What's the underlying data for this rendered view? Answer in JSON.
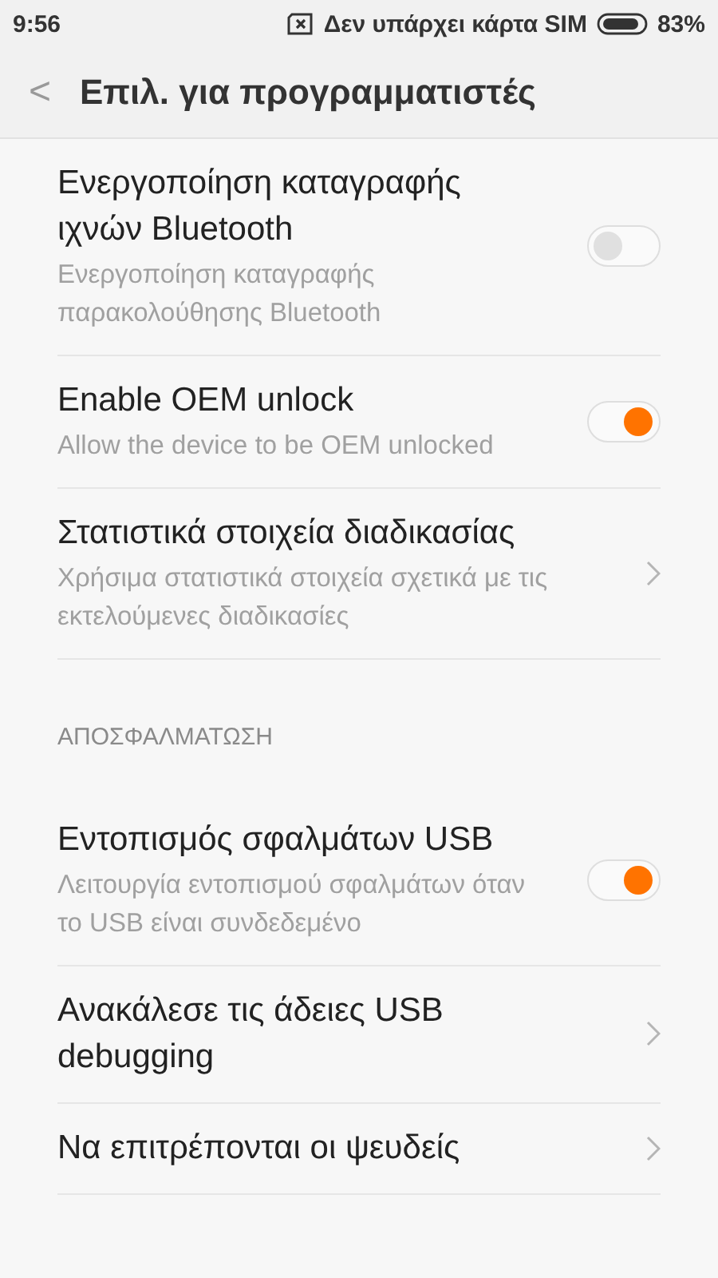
{
  "status_bar": {
    "time": "9:56",
    "carrier": "Δεν υπάρχει κάρτα SIM",
    "battery": "83%"
  },
  "header": {
    "back": "<",
    "title": "Επιλ. για προγραμματιστές"
  },
  "items": [
    {
      "kind": "toggle",
      "title": "Ενεργοποίηση καταγραφής ιχνών Bluetooth",
      "subtitle": "Ενεργοποίηση καταγραφής παρακολούθησης Bluetooth",
      "on": false
    },
    {
      "kind": "toggle",
      "title": "Enable OEM unlock",
      "subtitle": "Allow the device to be OEM unlocked",
      "on": true
    },
    {
      "kind": "link",
      "title": "Στατιστικά στοιχεία διαδικασίας",
      "subtitle": "Χρήσιμα στατιστικά στοιχεία σχετικά με τις εκτελούμενες διαδικασίες"
    },
    {
      "kind": "section",
      "title": "ΑΠΟΣΦΑΛΜΑΤΩΣΗ"
    },
    {
      "kind": "toggle",
      "title": "Εντοπισμός σφαλμάτων USB",
      "subtitle": "Λειτουργία εντοπισμού σφαλμάτων όταν το USB είναι συνδεδεμένο",
      "on": true
    },
    {
      "kind": "link",
      "title": "Ανακάλεσε τις άδειες USB debugging"
    },
    {
      "kind": "link",
      "title": "Να επιτρέπονται οι ψευδείς"
    }
  ]
}
